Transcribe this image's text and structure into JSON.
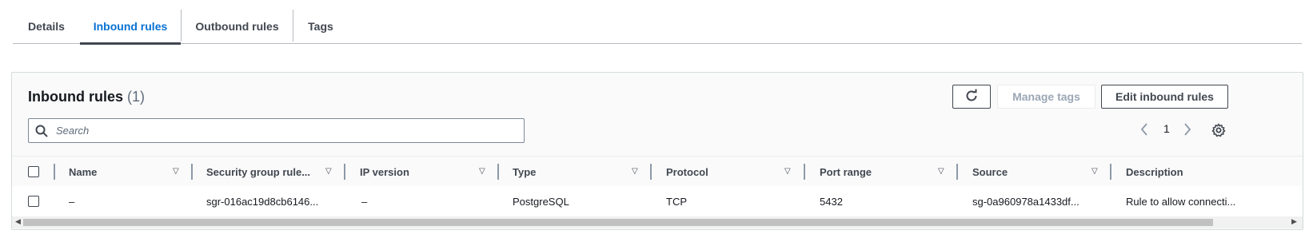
{
  "tabs": {
    "details": "Details",
    "inbound": "Inbound rules",
    "outbound": "Outbound rules",
    "tags": "Tags"
  },
  "panel": {
    "title": "Inbound rules",
    "count": "(1)",
    "refresh_icon": "refresh-icon",
    "manage_tags_label": "Manage tags",
    "edit_label": "Edit inbound rules",
    "search_placeholder": "Search",
    "search_icon": "search-icon",
    "page_number": "1",
    "prev_icon": "chevron-left-icon",
    "next_icon": "chevron-right-icon",
    "settings_icon": "gear-icon"
  },
  "table": {
    "headers": {
      "name": "Name",
      "rule_id": "Security group rule...",
      "ip_version": "IP version",
      "type": "Type",
      "protocol": "Protocol",
      "port_range": "Port range",
      "source": "Source",
      "description": "Description"
    },
    "rows": [
      {
        "name": "–",
        "rule_id": "sgr-016ac19d8cb6146...",
        "ip_version": "–",
        "type": "PostgreSQL",
        "protocol": "TCP",
        "port_range": "5432",
        "source": "sg-0a960978a1433df...",
        "description": "Rule to allow connecti..."
      }
    ]
  },
  "colors": {
    "accent": "#0972d3",
    "text": "#16191f",
    "muted": "#5f6b7a"
  }
}
